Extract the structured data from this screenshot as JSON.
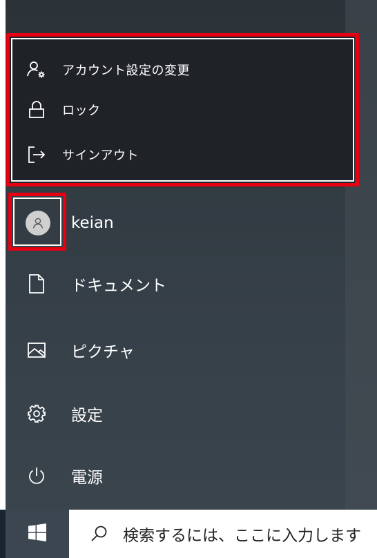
{
  "account_menu": {
    "items": [
      {
        "label": "アカウント設定の変更",
        "icon": "account-settings-icon"
      },
      {
        "label": "ロック",
        "icon": "lock-icon"
      },
      {
        "label": "サインアウト",
        "icon": "sign-out-icon"
      }
    ]
  },
  "user": {
    "name": "keian",
    "icon": "user-avatar-icon"
  },
  "nav": {
    "items": [
      {
        "label": "ドキュメント",
        "icon": "document-icon"
      },
      {
        "label": "ピクチャ",
        "icon": "pictures-icon"
      },
      {
        "label": "設定",
        "icon": "gear-icon"
      },
      {
        "label": "電源",
        "icon": "power-icon"
      }
    ]
  },
  "taskbar": {
    "start_icon": "windows-logo-icon",
    "search_placeholder": "検索するには、ここに入力します",
    "search_icon": "search-icon"
  },
  "colors": {
    "highlight": "#e60012",
    "menu_background": "#1f2327",
    "panel_background": "#323b42"
  }
}
